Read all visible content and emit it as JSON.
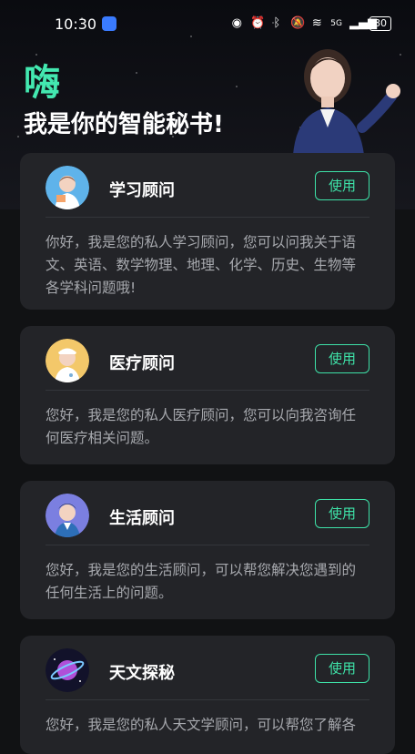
{
  "status": {
    "time": "10:30",
    "signal_label": "5G",
    "battery": "80"
  },
  "header": {
    "greeting": "嗨",
    "subtitle": "我是你的智能秘书!"
  },
  "use_label": "使用",
  "cards": [
    {
      "title": "学习顾问",
      "desc": "你好，我是您的私人学习顾问，您可以问我关于语文、英语、数学物理、地理、化学、历史、生物等各学科问题哦!"
    },
    {
      "title": "医疗顾问",
      "desc": "您好，我是您的私人医疗顾问，您可以向我咨询任何医疗相关问题。"
    },
    {
      "title": "生活顾问",
      "desc": "您好，我是您的生活顾问，可以帮您解决您遇到的任何生活上的问题。"
    },
    {
      "title": "天文探秘",
      "desc": "您好，我是您的私人天文学顾问，可以帮您了解各"
    }
  ],
  "colors": {
    "accent": "#3ee2a8",
    "greeting": "#43e8b0",
    "card_bg": "#232428",
    "page_bg": "#111214"
  }
}
